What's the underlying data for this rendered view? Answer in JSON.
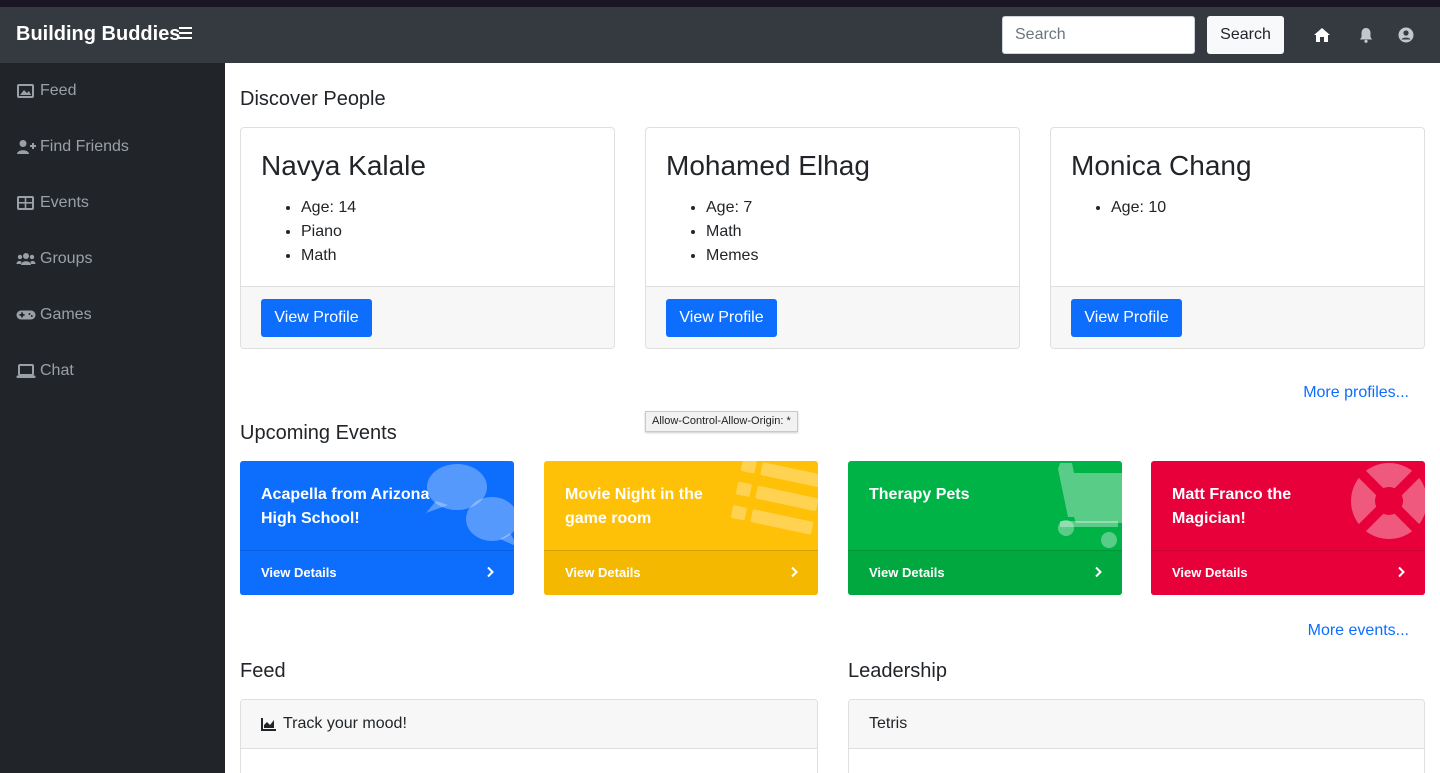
{
  "navbar": {
    "brand": "Building Buddies",
    "search_placeholder": "Search",
    "search_button": "Search"
  },
  "sidebar": {
    "items": [
      {
        "label": "Feed",
        "icon": "image-icon"
      },
      {
        "label": "Find Friends",
        "icon": "user-plus-icon"
      },
      {
        "label": "Events",
        "icon": "table-icon"
      },
      {
        "label": "Groups",
        "icon": "users-icon"
      },
      {
        "label": "Games",
        "icon": "gamepad-icon"
      },
      {
        "label": "Chat",
        "icon": "laptop-icon"
      }
    ]
  },
  "discover": {
    "title": "Discover People",
    "people": [
      {
        "name": "Navya Kalale",
        "facts": [
          "Age: 14",
          "Piano",
          "Math"
        ],
        "button": "View Profile"
      },
      {
        "name": "Mohamed Elhag",
        "facts": [
          "Age: 7",
          "Math",
          "Memes"
        ],
        "button": "View Profile"
      },
      {
        "name": "Monica Chang",
        "facts": [
          "Age: 10"
        ],
        "button": "View Profile"
      }
    ],
    "more": "More profiles..."
  },
  "tooltip": "Allow-Control-Allow-Origin: *",
  "events": {
    "title": "Upcoming Events",
    "items": [
      {
        "title": "Acapella from Arizona High School!",
        "detail": "View Details",
        "color": "#0d6efd",
        "icon": "comments-icon"
      },
      {
        "title": "Movie Night in the game room",
        "detail": "View Details",
        "color": "#ffc107",
        "icon": "list-icon"
      },
      {
        "title": "Therapy Pets",
        "detail": "View Details",
        "color": "#00b347",
        "icon": "cart-icon"
      },
      {
        "title": "Matt Franco the Magician!",
        "detail": "View Details",
        "color": "#e8003a",
        "icon": "life-ring-icon"
      }
    ],
    "more": "More events..."
  },
  "feed": {
    "title": "Feed",
    "card_header": "Track your mood!"
  },
  "leadership": {
    "title": "Leadership",
    "card_header": "Tetris"
  }
}
